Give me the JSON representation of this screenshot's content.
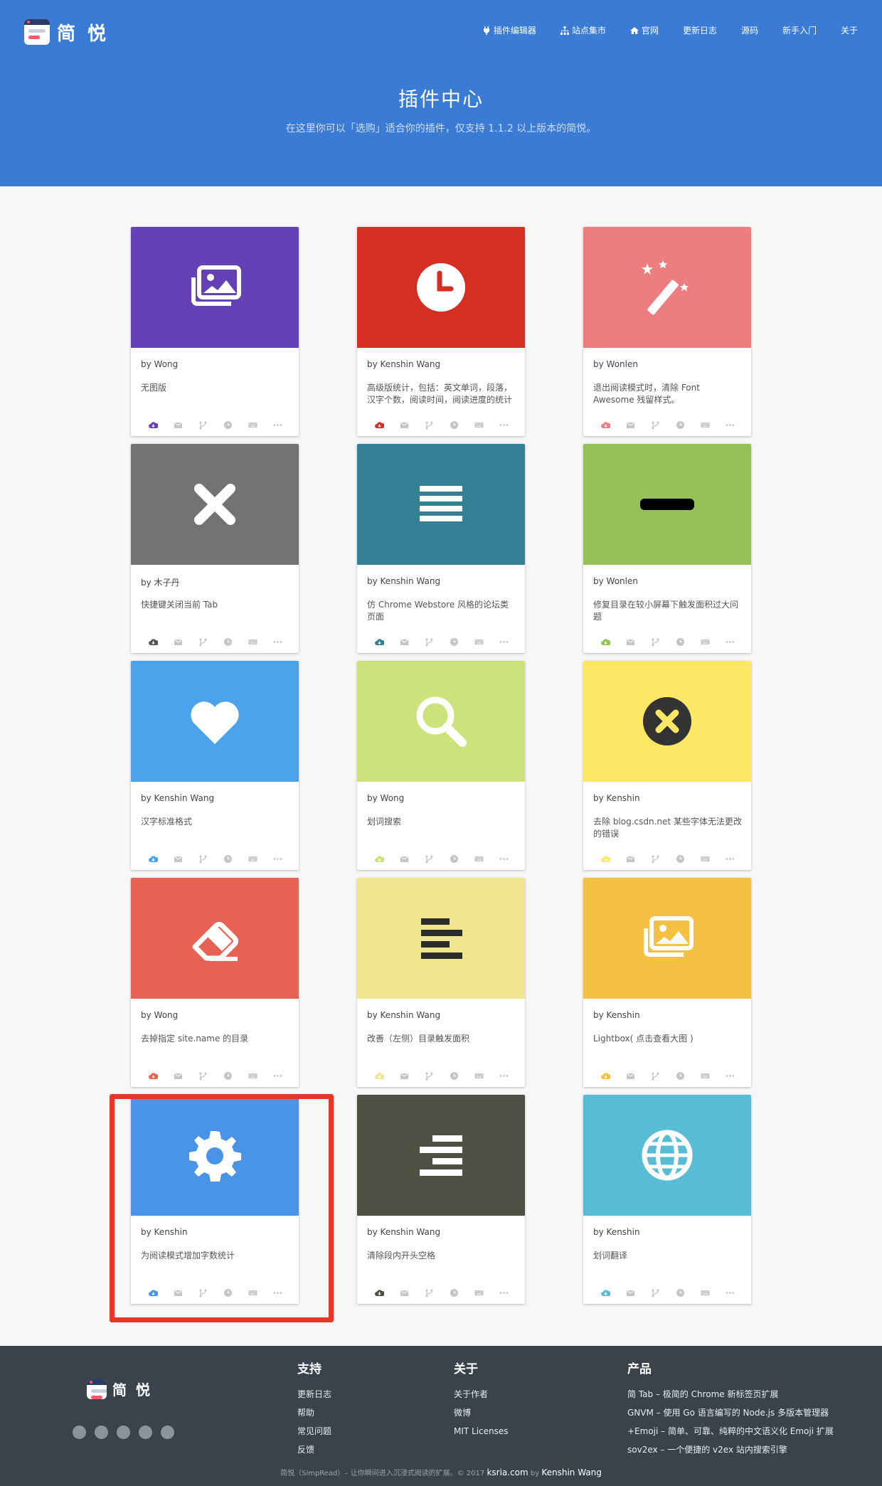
{
  "brand": {
    "name": "简 悦"
  },
  "nav": [
    {
      "label": "插件编辑器",
      "icon": "plug-icon"
    },
    {
      "label": "站点集市",
      "icon": "sitemap-icon"
    },
    {
      "label": "官网",
      "icon": "home-icon"
    },
    {
      "label": "更新日志",
      "icon": ""
    },
    {
      "label": "源码",
      "icon": ""
    },
    {
      "label": "新手入门",
      "icon": ""
    },
    {
      "label": "关于",
      "icon": ""
    }
  ],
  "hero": {
    "title": "插件中心",
    "subtitle": "在这里你可以「选购」适合你的插件，仅支持 1.1.2 以上版本的简悦。"
  },
  "cards": [
    {
      "author": "by Wong",
      "desc": "无图版",
      "cover_color": "#6541b6",
      "icon": "images-icon",
      "icon_color": "#ffffff",
      "accent": "#6541b6"
    },
    {
      "author": "by Kenshin Wang",
      "desc": "高级版统计，包括：英文单词，段落，汉字个数，阅读时间，阅读进度的统计",
      "cover_color": "#d52e22",
      "icon": "clock-icon",
      "icon_color": "#ffffff",
      "accent": "#d52e22"
    },
    {
      "author": "by Wonlen",
      "desc": "退出阅读模式时，清除 Font Awesome 残留样式。",
      "cover_color": "#ee7d80",
      "icon": "magic-wand-icon",
      "icon_color": "#ffffff",
      "accent": "#ee7d80"
    },
    {
      "author": "by 木子丹",
      "desc": "快捷键关闭当前 Tab",
      "cover_color": "#737373",
      "icon": "close-icon",
      "icon_color": "#ffffff",
      "accent": "#555555"
    },
    {
      "author": "by Kenshin Wang",
      "desc": "仿 Chrome Webstore 风格的论坛类页面",
      "cover_color": "#357f95",
      "icon": "align-justify-icon",
      "icon_color": "#ffffff",
      "accent": "#357f95"
    },
    {
      "author": "by Wonlen",
      "desc": "修复目录在较小屏幕下触发面积过大问题",
      "cover_color": "#96c158",
      "icon": "minus-icon",
      "icon_color": "#000000",
      "accent": "#96c158"
    },
    {
      "author": "by Kenshin Wang",
      "desc": "汉字标准格式",
      "cover_color": "#4ba3ec",
      "icon": "heart-icon",
      "icon_color": "#ffffff",
      "accent": "#4ba3ec"
    },
    {
      "author": "by Wong",
      "desc": "划词搜索",
      "cover_color": "#cde27a",
      "icon": "search-icon",
      "icon_color": "#ffffff",
      "accent": "#cde27a"
    },
    {
      "author": "by Kenshin",
      "desc": "去除 blog.csdn.net 某些字体无法更改的错误",
      "cover_color": "#fde764",
      "icon": "times-circle-icon",
      "icon_color": "#333333",
      "accent": "#fde764"
    },
    {
      "author": "by Wong",
      "desc": "去掉指定 site.name 的目录",
      "cover_color": "#e86152",
      "icon": "eraser-icon",
      "icon_color": "#ffffff",
      "accent": "#e86152"
    },
    {
      "author": "by Kenshin Wang",
      "desc": "改善（左侧）目录触发面积",
      "cover_color": "#f1e690",
      "icon": "align-left-icon",
      "icon_color": "#2c2c2c",
      "accent": "#f1e690"
    },
    {
      "author": "by Kenshin",
      "desc": "Lightbox( 点击查看大图 )",
      "cover_color": "#f5c142",
      "icon": "images-icon",
      "icon_color": "#ffffff",
      "accent": "#f5c142"
    },
    {
      "author": "by Kenshin",
      "desc": "为阅读模式增加字数统计",
      "cover_color": "#4a94e8",
      "icon": "gear-icon",
      "icon_color": "#ffffff",
      "accent": "#4a94e8"
    },
    {
      "author": "by Kenshin Wang",
      "desc": "清除段内开头空格",
      "cover_color": "#4f5043",
      "icon": "align-right-icon",
      "icon_color": "#ffffff",
      "accent": "#4f5043"
    },
    {
      "author": "by Kenshin",
      "desc": "划词翻译",
      "cover_color": "#58bcd5",
      "icon": "globe-icon",
      "icon_color": "#ffffff",
      "accent": "#58bcd5"
    }
  ],
  "footer": {
    "brand": "简 悦",
    "columns": [
      {
        "title": "支持",
        "links": [
          "更新日志",
          "帮助",
          "常见问题",
          "反馈"
        ]
      },
      {
        "title": "关于",
        "links": [
          "关于作者",
          "微博",
          "MIT Licenses"
        ]
      },
      {
        "title": "产品",
        "links": [
          "简 Tab – 极简的 Chrome 新标签页扩展",
          "GNVM – 使用 Go 语言编写的 Node.js 多版本管理器",
          "+Emoji – 简单、可靠、纯粹的中文语义化 Emoji 扩展",
          "sov2ex – 一个便捷的 v2ex 站内搜索引擎"
        ]
      }
    ],
    "copyright_prefix": "简悦（SimpRead）– 让你瞬间进入沉浸式阅读的扩展。© 2017",
    "site": "ksria.com",
    "by": "by",
    "author": "Kenshin Wang"
  }
}
